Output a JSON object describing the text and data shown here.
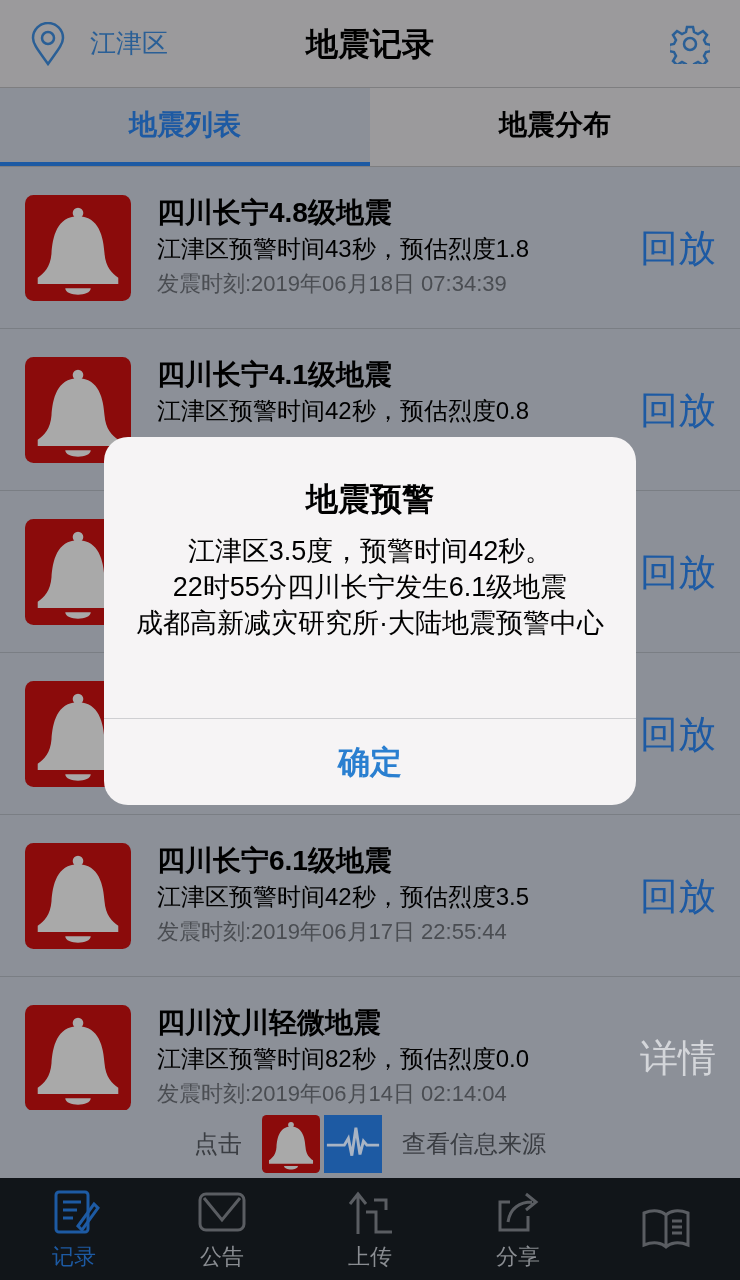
{
  "header": {
    "location": "江津区",
    "title": "地震记录"
  },
  "tabs": [
    {
      "label": "地震列表",
      "selected": true
    },
    {
      "label": "地震分布",
      "selected": false
    }
  ],
  "records": [
    {
      "title": "四川长宁4.8级地震",
      "warning": "江津区预警时间43秒，预估烈度1.8",
      "time": "发震时刻:2019年06月18日 07:34:39",
      "action": {
        "kind": "replay",
        "label": "回放"
      }
    },
    {
      "title": "四川长宁4.1级地震",
      "warning": "江津区预警时间42秒，预估烈度0.8",
      "action": {
        "kind": "replay",
        "label": "回放"
      }
    },
    {
      "action": {
        "kind": "replay",
        "label": "回放"
      }
    },
    {
      "action": {
        "kind": "replay",
        "label": "回放"
      }
    },
    {
      "title": "四川长宁6.1级地震",
      "warning": "江津区预警时间42秒，预估烈度3.5",
      "time": "发震时刻:2019年06月17日 22:55:44",
      "action": {
        "kind": "replay",
        "label": "回放"
      }
    },
    {
      "title": "四川汶川轻微地震",
      "warning": "江津区预警时间82秒，预估烈度0.0",
      "time": "发震时刻:2019年06月14日 02:14:04",
      "action": {
        "kind": "details",
        "label": "详情"
      }
    }
  ],
  "hint": {
    "before": "点击",
    "after": "查看信息来源"
  },
  "tab_bar": [
    {
      "kind": "record",
      "label": "记录",
      "selected": true
    },
    {
      "kind": "notice",
      "label": "公告",
      "selected": false
    },
    {
      "kind": "upload",
      "label": "上传",
      "selected": false
    },
    {
      "kind": "share",
      "label": "分享",
      "selected": false
    },
    {
      "kind": "book",
      "selected": false
    }
  ],
  "alert": {
    "title": "地震预警",
    "lines": [
      "江津区3.5度，预警时间42秒。",
      "22时55分四川长宁发生6.1级地震",
      "成都高新减灾研究所·大陆地震预警中心"
    ],
    "button": "确定"
  }
}
